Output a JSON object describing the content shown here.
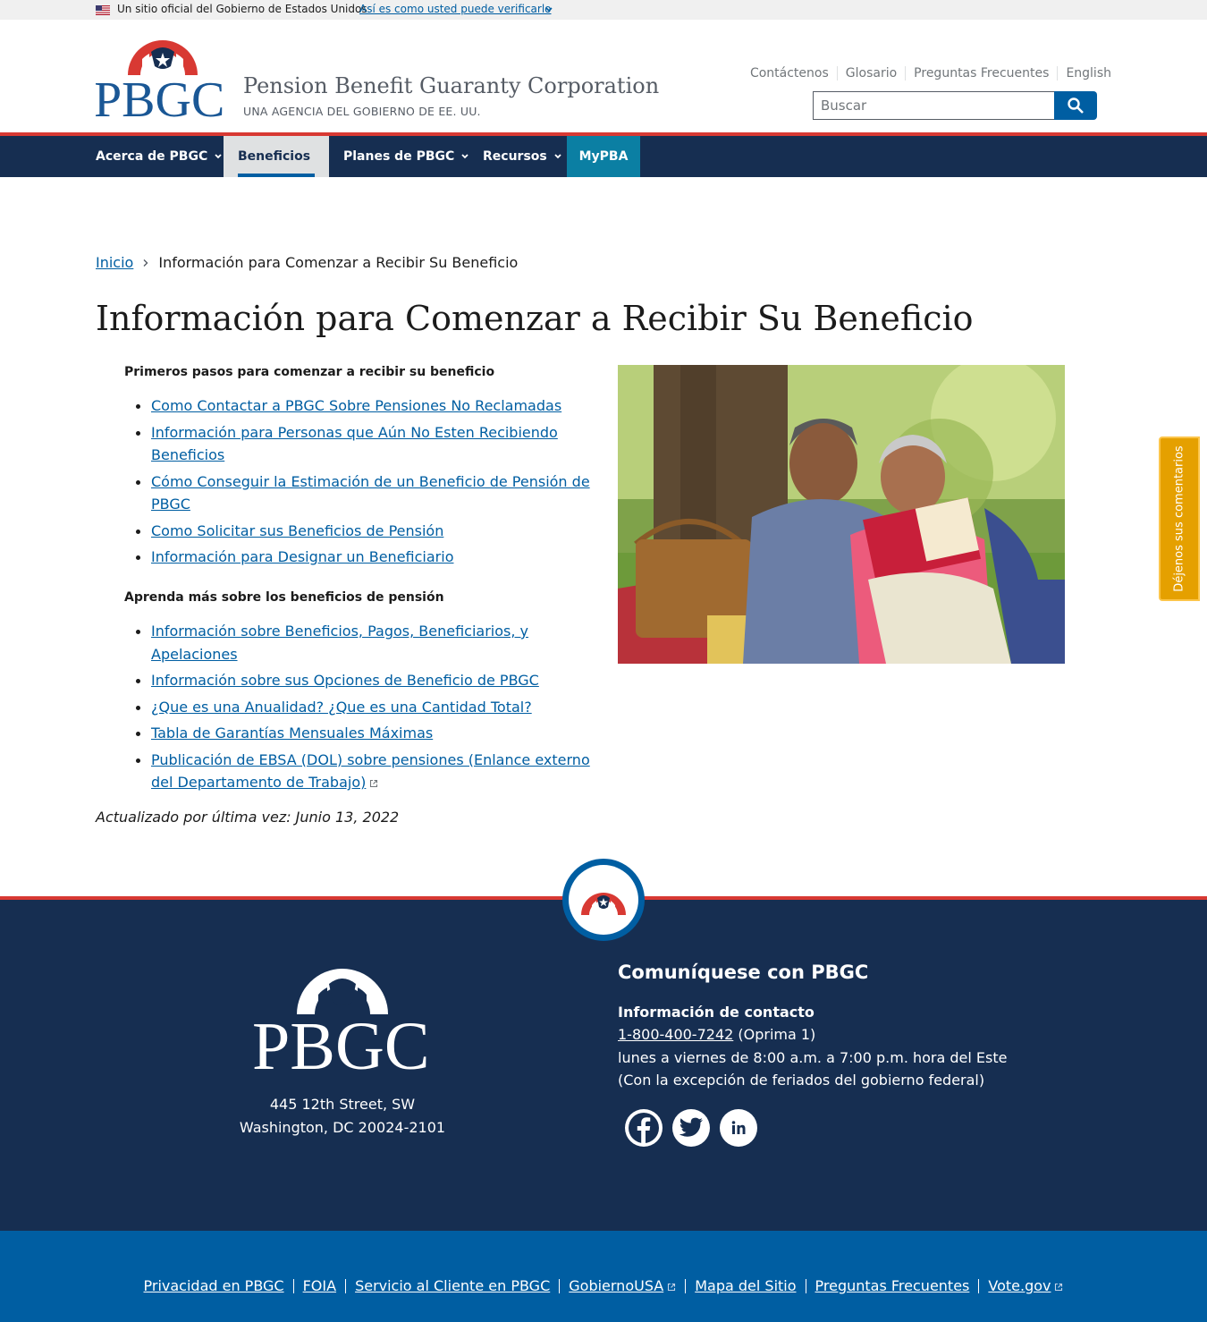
{
  "gov_banner": {
    "official_text": "Un sitio oficial del Gobierno de Estados Unidos",
    "verify_link": "Así es como usted puede verificarlo"
  },
  "header": {
    "logo_text": "PBGC",
    "title": "Pension Benefit Guaranty Corporation",
    "subtitle": "UNA AGENCIA DEL GOBIERNO DE EE. UU.",
    "utility_links": [
      "Contáctenos",
      "Glosario",
      "Preguntas Frecuentes",
      "English"
    ],
    "search": {
      "placeholder": "Buscar"
    }
  },
  "nav": {
    "items": [
      {
        "label": "Acerca de PBGC",
        "has_dropdown": true
      },
      {
        "label": "Beneficios",
        "has_dropdown": true,
        "active": true
      },
      {
        "label": "Planes de PBGC",
        "has_dropdown": true
      },
      {
        "label": "Recursos",
        "has_dropdown": true
      },
      {
        "label": "MyPBA",
        "has_dropdown": false
      }
    ]
  },
  "breadcrumb": {
    "home": "Inicio",
    "current": "Información para Comenzar a Recibir Su Beneficio"
  },
  "page": {
    "title": "Información para Comenzar a Recibir Su Beneficio",
    "section1": {
      "heading": "Primeros pasos para comenzar a recibir su beneficio",
      "links": [
        "Como Contactar a PBGC Sobre Pensiones No Reclamadas",
        "Información para Personas que Aún No Esten Recibiendo Beneficios",
        "Cómo Conseguir la Estimación de un Beneficio de Pensión de PBGC",
        "Como Solicitar sus Beneficios de Pensión",
        "Información para Designar un Beneficiario"
      ]
    },
    "section2": {
      "heading": "Aprenda más sobre los beneficios de pensión",
      "links": [
        "Información sobre Beneficios, Pagos, Beneficiarios, y Apelaciones",
        "Información sobre sus Opciones de Beneficio de PBGC",
        "¿Que es una Anualidad? ¿Que es una Cantidad Total?",
        "Tabla de Garantías Mensuales Máximas ",
        "Publicación de EBSA (DOL) sobre pensiones (Enlance externo del Departamento de Trabajo)"
      ]
    },
    "updated": "Actualizado por última vez: Junio 13, 2022"
  },
  "feedback_tab": "Déjenos sus comentarios",
  "footer": {
    "logo_text": "PBGC",
    "address_line1": "445 12th Street, SW",
    "address_line2": "Washington, DC 20024-2101",
    "contact_title": "Comuníquese con PBGC",
    "contact_label": "Información de contacto",
    "phone": "1-800-400-7242",
    "phone_note": " (Oprima 1)",
    "hours": "lunes a viernes de 8:00 a.m. a 7:00 p.m. hora del Este",
    "holidays": "(Con la excepción de feriados del gobierno federal)",
    "social": [
      "facebook-icon",
      "twitter-icon",
      "linkedin-icon"
    ],
    "bottom_links": [
      "Privacidad en PBGC",
      "FOIA",
      "Servicio al Cliente en PBGC",
      "GobiernoUSA",
      "Mapa del Sitio",
      "Preguntas Frecuentes",
      "Vote.gov"
    ]
  },
  "colors": {
    "navy": "#162e51",
    "primary": "#005ea2",
    "red": "#d83933",
    "feedback": "#e5a000",
    "mypba": "#0b7fa3"
  }
}
